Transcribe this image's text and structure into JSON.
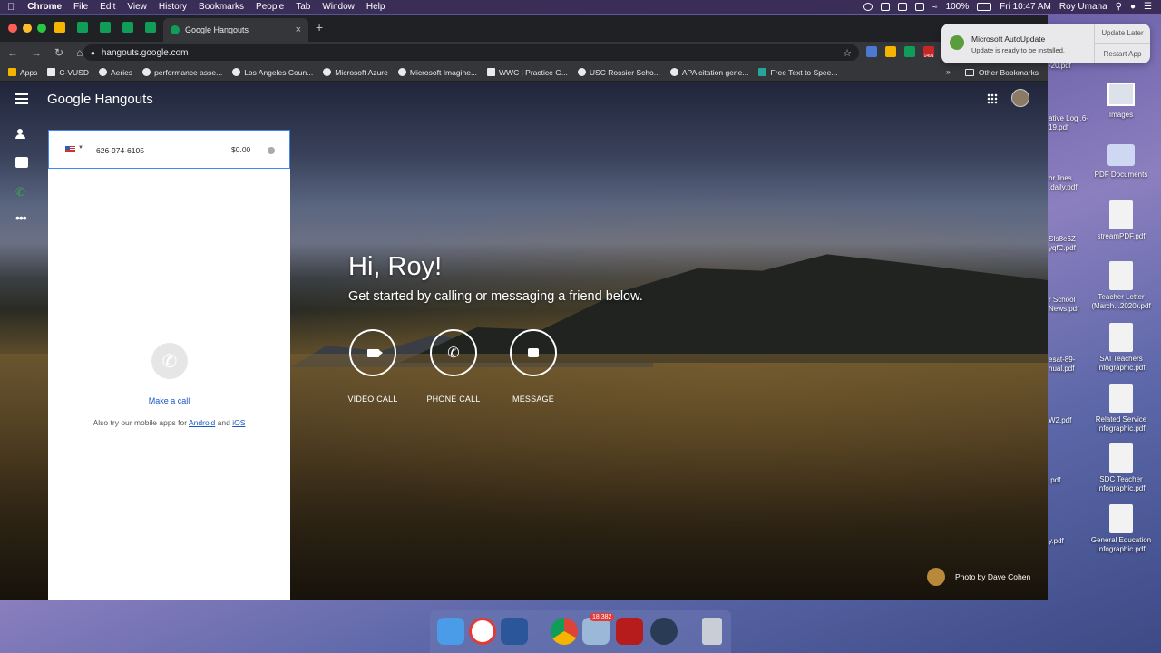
{
  "menubar": {
    "app": "Chrome",
    "menus": [
      "File",
      "Edit",
      "View",
      "History",
      "Bookmarks",
      "People",
      "Tab",
      "Window",
      "Help"
    ],
    "battery": "100%",
    "clock": "Fri 10:47 AM",
    "user": "Roy Umana"
  },
  "browser": {
    "tab_title": "Google Hangouts",
    "url": "hangouts.google.com",
    "bookmarks": [
      "Apps",
      "C-VUSD",
      "Aeries",
      "performance asse...",
      "Los Angeles Coun...",
      "Microsoft Azure",
      "Microsoft Imagine...",
      "WWC | Practice G...",
      "USC Rossier Scho...",
      "APA citation gene...",
      "Free Text to Spee..."
    ],
    "overflow": "»",
    "other_bookmarks": "Other Bookmarks",
    "ext_badge": "1491"
  },
  "hangouts": {
    "brand": "Google Hangouts",
    "dialer": {
      "value": "626-974-6105",
      "rate": "$0.00"
    },
    "empty": {
      "make_call": "Make a call",
      "note_prefix": "Also try our mobile apps for ",
      "android": "Android",
      "and": " and ",
      "ios": "iOS"
    },
    "greeting": "Hi, Roy!",
    "subtitle": "Get started by calling or messaging a friend below.",
    "actions": [
      {
        "label": "VIDEO CALL",
        "icon": "video-camera-icon"
      },
      {
        "label": "PHONE CALL",
        "icon": "phone-icon"
      },
      {
        "label": "MESSAGE",
        "icon": "message-icon"
      }
    ],
    "photo_credit": "Photo by Dave Cohen"
  },
  "notification": {
    "title": "Microsoft AutoUpdate",
    "body": "Update is ready to be installed.",
    "btn_later": "Update Later",
    "btn_restart": "Restart App"
  },
  "desktop": {
    "icons": [
      {
        "label": "Images"
      },
      {
        "label": "PDF Documents"
      },
      {
        "label": "streamPDF.pdf"
      },
      {
        "label": "Teacher Letter (March...2020).pdf"
      },
      {
        "label": "SAI Teachers Infographic.pdf"
      },
      {
        "label": "Related Service Infographic.pdf"
      },
      {
        "label": "SDC Teacher Infographic.pdf"
      },
      {
        "label": "General Education Infographic.pdf"
      }
    ],
    "partial_labels": [
      "-20.pdf",
      "ative Log .6-19.pdf",
      "or lines .daily.pdf",
      "SIs8e6Z yqfC.pdf",
      "r School News.pdf",
      "esat-89- nual.pdf",
      "W2.pdf",
      ".pdf",
      "y.pdf"
    ]
  },
  "dock": {
    "badge": "18,382"
  }
}
